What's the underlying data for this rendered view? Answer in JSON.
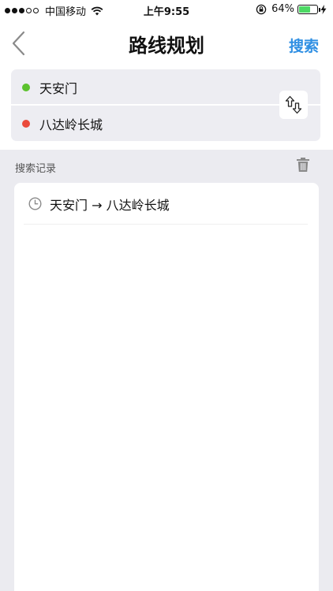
{
  "status_bar": {
    "carrier": "中国移动",
    "time": "上午9:55",
    "battery_percent": "64%",
    "battery_level": 0.64,
    "signal_bars_filled": 3,
    "signal_bars_total": 5
  },
  "navbar": {
    "title": "路线规划",
    "search_label": "搜索",
    "back_icon": "chevron-left-icon"
  },
  "route": {
    "start": {
      "label": "天安门",
      "color": "#5cc22e"
    },
    "end": {
      "label": "八达岭长城",
      "color": "#ea4a3b"
    },
    "swap_icon": "swap-vertical-icon"
  },
  "history": {
    "section_label": "搜索记录",
    "clear_icon": "trash-icon",
    "items": [
      {
        "text": "天安门 → 八达岭长城",
        "icon": "clock-icon"
      }
    ]
  },
  "colors": {
    "accent": "#2f8fe3",
    "panel_bg": "#ededf2",
    "page_bg": "#ebebf0"
  }
}
